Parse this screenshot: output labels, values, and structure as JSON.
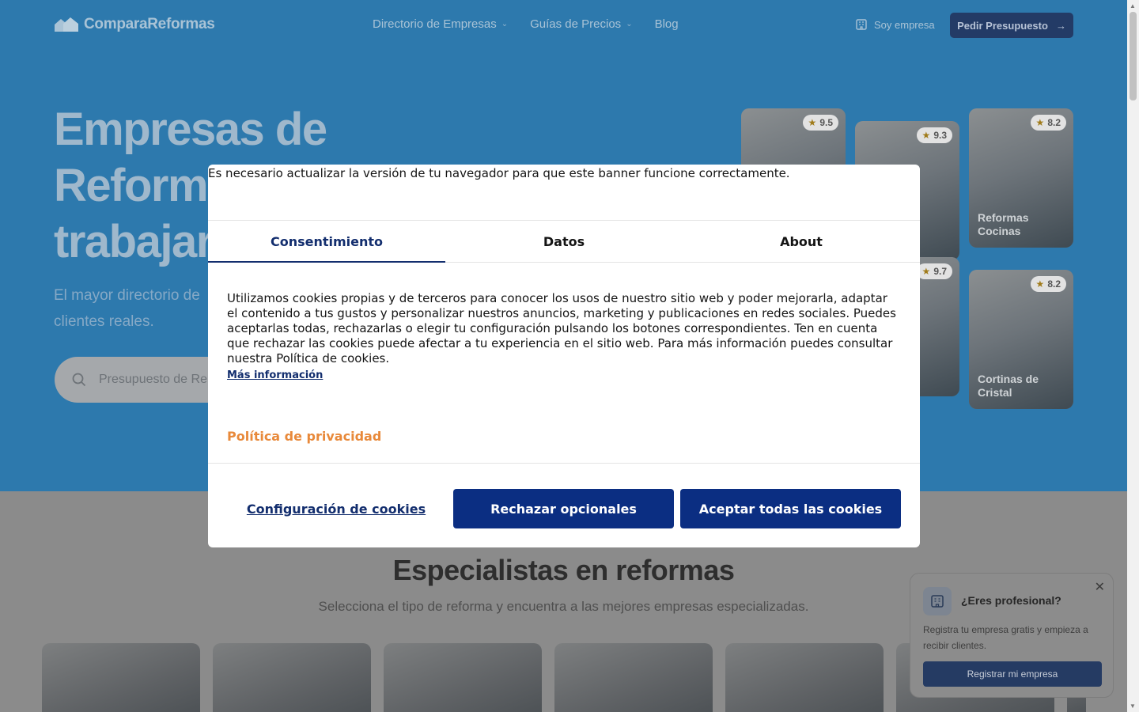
{
  "nav": {
    "logo": "ComparaReformas",
    "links": [
      "Directorio de Empresas",
      "Guías de Precios",
      "Blog"
    ],
    "soy_empresa": "Soy empresa",
    "pedir_presupuesto": "Pedir Presupuesto"
  },
  "hero": {
    "title_lines": [
      "Empresas de",
      "Reform",
      "trabajar"
    ],
    "subtitle_lines": [
      "El mayor directorio de",
      "clientes reales."
    ],
    "search_placeholder": "Presupuesto de Re"
  },
  "cards": [
    {
      "rating": "9.5",
      "label": ""
    },
    {
      "rating": "9.3",
      "label": ""
    },
    {
      "rating": "8.2",
      "label": "Reformas Cocinas"
    },
    {
      "rating": "9.7",
      "label": ""
    },
    {
      "rating": "8.2",
      "label": "Cortinas de Cristal"
    }
  ],
  "section": {
    "title": "Especialistas en reformas",
    "subtitle": "Selecciona el tipo de reforma y encuentra a las mejores empresas especializadas."
  },
  "pro_popup": {
    "title": "¿Eres profesional?",
    "text": "Registra tu empresa gratis y empieza a recibir clientes.",
    "button": "Registrar mi empresa"
  },
  "cookie_banner": {
    "warning": "Es necesario actualizar la versión de tu navegador para que este banner funcione correctamente.",
    "tabs": [
      "Consentimiento",
      "Datos",
      "About"
    ],
    "active_tab": "Consentimiento",
    "body": "Utilizamos cookies propias y de terceros para conocer los usos de nuestro sitio web y poder mejorarla, adaptar el contenido a tus gustos y personalizar nuestros anuncios, marketing y publicaciones en redes sociales. Puedes aceptarlas todas, rechazarlas o elegir tu configuración pulsando los botones correspondientes. Ten en cuenta que rechazar las cookies puede afectar a tu experiencia en el sitio web. Para más información puedes consultar nuestra Política de cookies.",
    "more_info": "Más información",
    "privacy_policy": "Política de privacidad",
    "btn_config": "Configuración de cookies",
    "btn_reject": "Rechazar opcionales",
    "btn_accept": "Aceptar todas las cookies"
  },
  "colors": {
    "hero_bg": "#2d79ad",
    "brand_dark": "#0b2e82",
    "privacy_orange": "#e8893a"
  }
}
